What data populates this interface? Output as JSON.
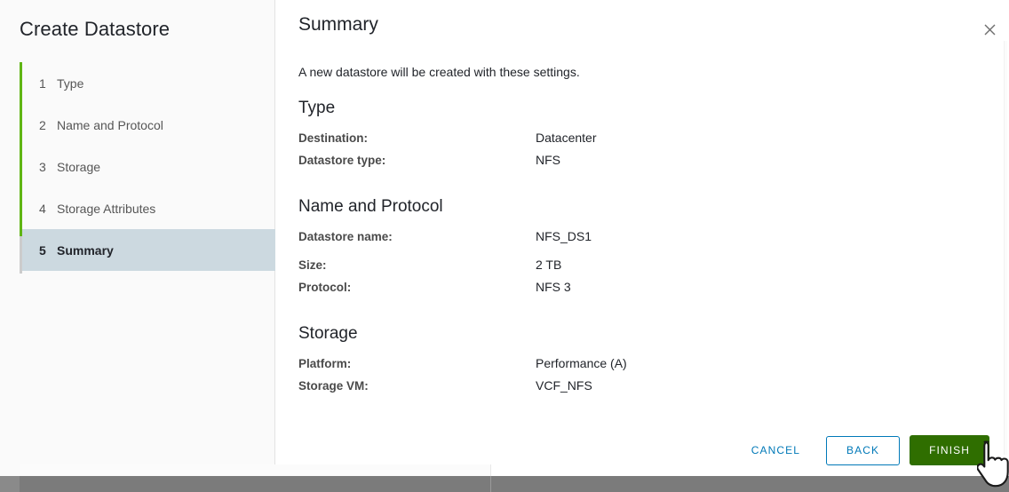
{
  "wizard": {
    "title": "Create Datastore",
    "steps": [
      {
        "num": "1",
        "label": "Type"
      },
      {
        "num": "2",
        "label": "Name and Protocol"
      },
      {
        "num": "3",
        "label": "Storage"
      },
      {
        "num": "4",
        "label": "Storage Attributes"
      },
      {
        "num": "5",
        "label": "Summary"
      }
    ],
    "active_step_index": 4
  },
  "panel": {
    "title": "Summary",
    "intro": "A new datastore will be created with these settings.",
    "close_icon": "close-icon",
    "sections": [
      {
        "heading": "Type",
        "rows": [
          {
            "label": "Destination:",
            "value": "Datacenter"
          },
          {
            "label": "Datastore type:",
            "value": "NFS"
          }
        ]
      },
      {
        "heading": "Name and Protocol",
        "rows": [
          {
            "label": "Datastore name:",
            "value": "NFS_DS1"
          },
          {
            "label": "Size:",
            "value": "2 TB"
          },
          {
            "label": "Protocol:",
            "value": "NFS 3"
          }
        ]
      },
      {
        "heading": "Storage",
        "rows": [
          {
            "label": "Platform:",
            "value": "Performance (A)"
          },
          {
            "label": "Storage VM:",
            "value": "VCF_NFS"
          }
        ]
      }
    ]
  },
  "footer": {
    "cancel_label": "CANCEL",
    "back_label": "BACK",
    "finish_label": "FINISH"
  },
  "colors": {
    "accent_green": "#60b515",
    "primary_green": "#2f6e00",
    "link_blue": "#0079b8",
    "active_step_bg": "#ccd9e0",
    "sidebar_bg": "#fafafa",
    "text_dark": "#21242a",
    "text_muted": "#565656",
    "under_strip": "#7b7b7b"
  },
  "cursor": {
    "type": "pointing-hand"
  }
}
